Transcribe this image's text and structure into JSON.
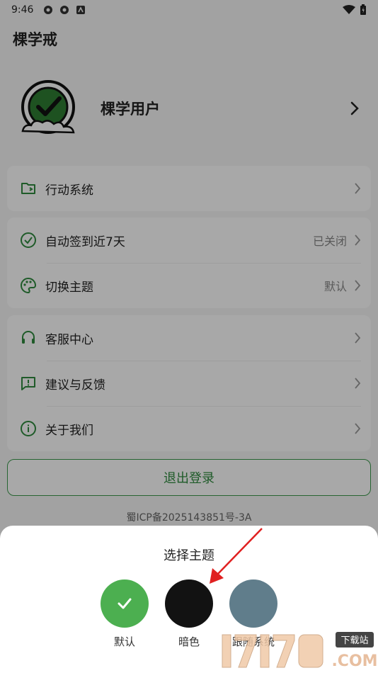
{
  "status_bar": {
    "time": "9:46"
  },
  "app": {
    "title": "棵学戒"
  },
  "profile": {
    "username": "棵学用户"
  },
  "menu": {
    "action_system": "行动系统",
    "auto_checkin": {
      "label": "自动签到近7天",
      "value": "已关闭"
    },
    "switch_theme": {
      "label": "切换主题",
      "value": "默认"
    },
    "customer_service": "客服中心",
    "feedback": "建议与反馈",
    "about": "关于我们"
  },
  "logout_label": "退出登录",
  "icp": "蜀ICP备2025143851号-3A",
  "theme_sheet": {
    "title": "选择主题",
    "options": [
      {
        "label": "默认",
        "color": "#4caf50",
        "selected": true
      },
      {
        "label": "暗色",
        "color": "#121212",
        "selected": false
      },
      {
        "label": "跟随系统",
        "color": "#607d8b",
        "selected": false
      }
    ]
  },
  "colors": {
    "accent": "#2f8b3f",
    "annotation_arrow": "#e02020"
  }
}
